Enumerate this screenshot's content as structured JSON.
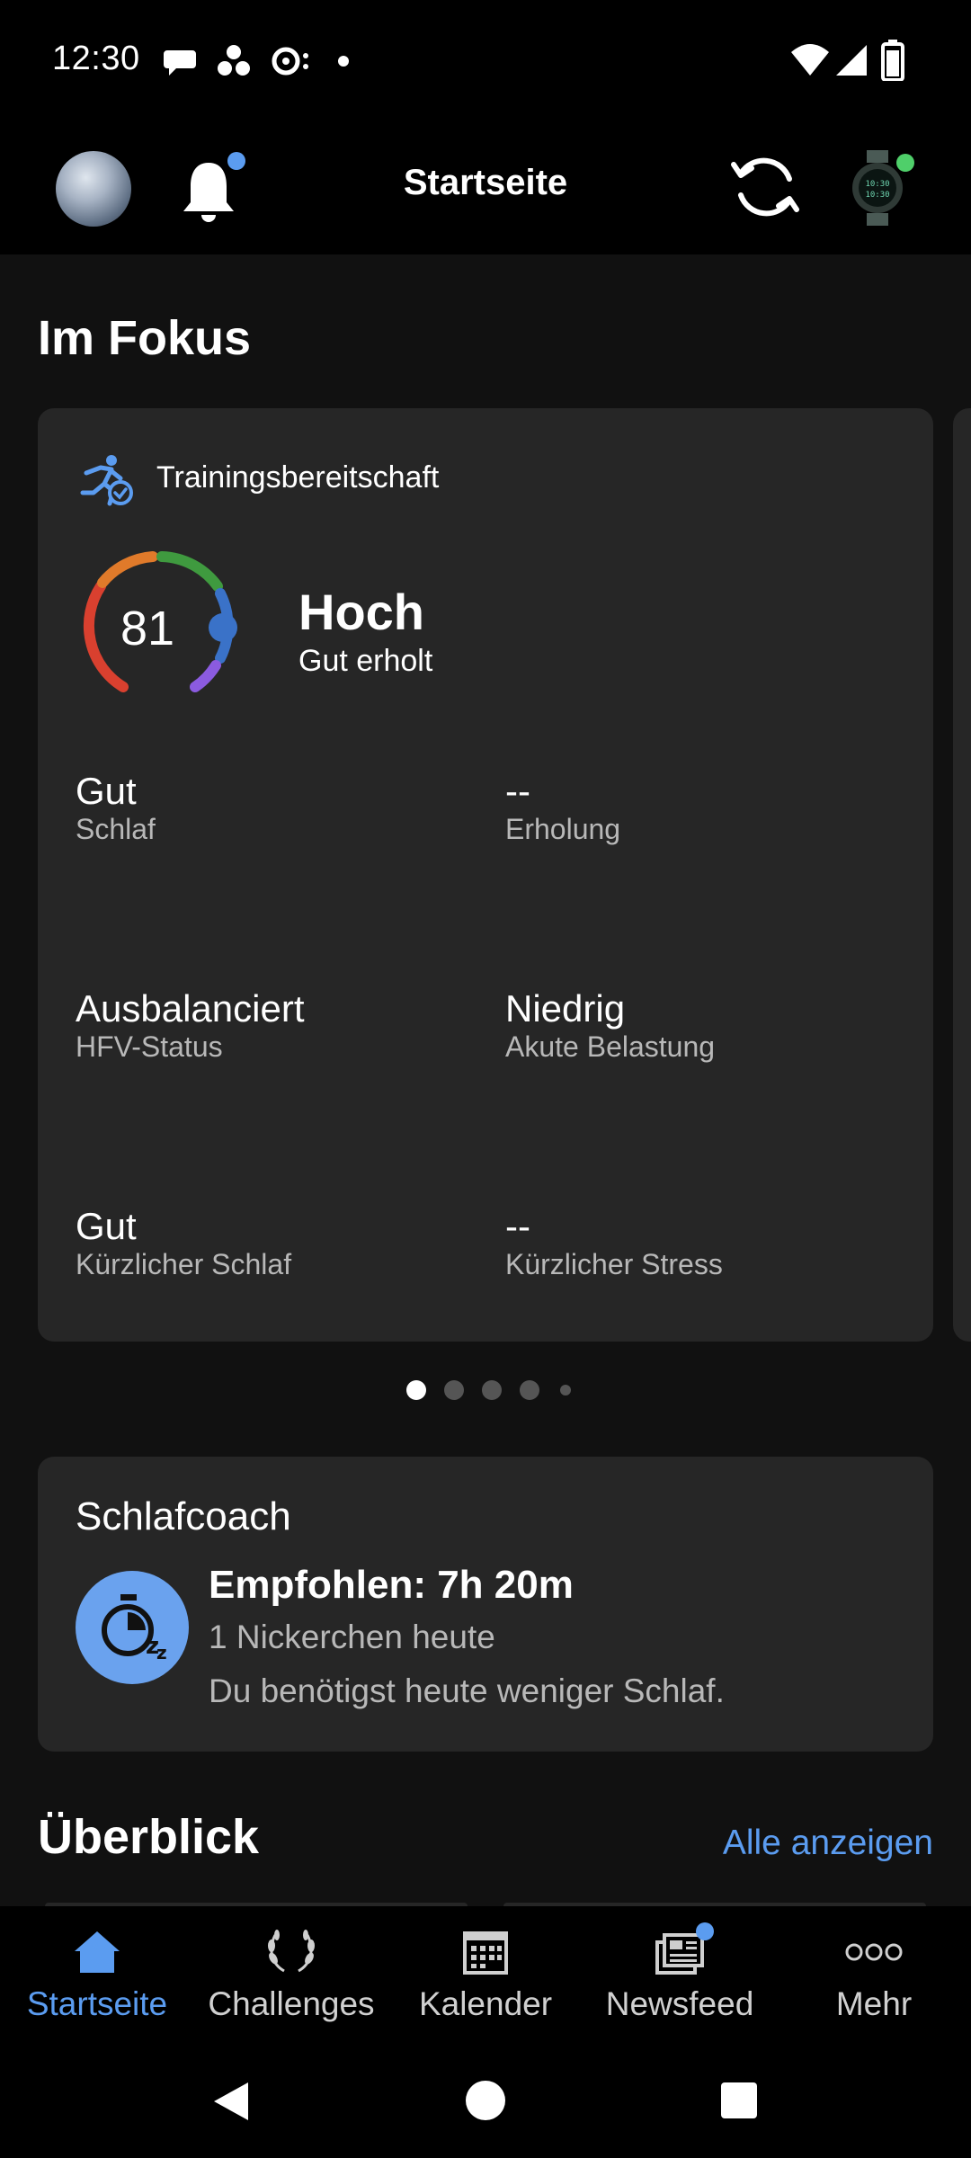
{
  "status_bar": {
    "time": "12:30"
  },
  "header": {
    "title": "Startseite"
  },
  "focus": {
    "title": "Im Fokus",
    "card": {
      "title": "Trainingsbereitschaft",
      "score": "81",
      "level": "Hoch",
      "sublevel": "Gut erholt",
      "stats": [
        {
          "value": "Gut",
          "label": "Schlaf"
        },
        {
          "value": "--",
          "label": "Erholung"
        },
        {
          "value": "Ausbalanciert",
          "label": "HFV-Status"
        },
        {
          "value": "Niedrig",
          "label": "Akute Belastung"
        },
        {
          "value": "Gut",
          "label": "Kürzlicher Schlaf"
        },
        {
          "value": "--",
          "label": "Kürzlicher Stress"
        }
      ]
    },
    "pager": {
      "count": 5,
      "active": 0
    }
  },
  "sleep_coach": {
    "title": "Schlafcoach",
    "headline": "Empfohlen: 7h 20m",
    "line1": "1 Nickerchen heute",
    "line2": "Du benötigst heute weniger Schlaf."
  },
  "overview": {
    "title": "Überblick",
    "link": "Alle anzeigen"
  },
  "bottom_nav": [
    {
      "label": "Startseite",
      "icon": "home-icon",
      "active": true
    },
    {
      "label": "Challenges",
      "icon": "laurel-icon",
      "active": false
    },
    {
      "label": "Kalender",
      "icon": "calendar-icon",
      "active": false
    },
    {
      "label": "Newsfeed",
      "icon": "newsfeed-icon",
      "active": false
    },
    {
      "label": "Mehr",
      "icon": "more-icon",
      "active": false
    }
  ],
  "colors": {
    "accent": "#5b9cf0",
    "card": "#262626",
    "background": "#111111",
    "green_dot": "#4fcf6a"
  }
}
